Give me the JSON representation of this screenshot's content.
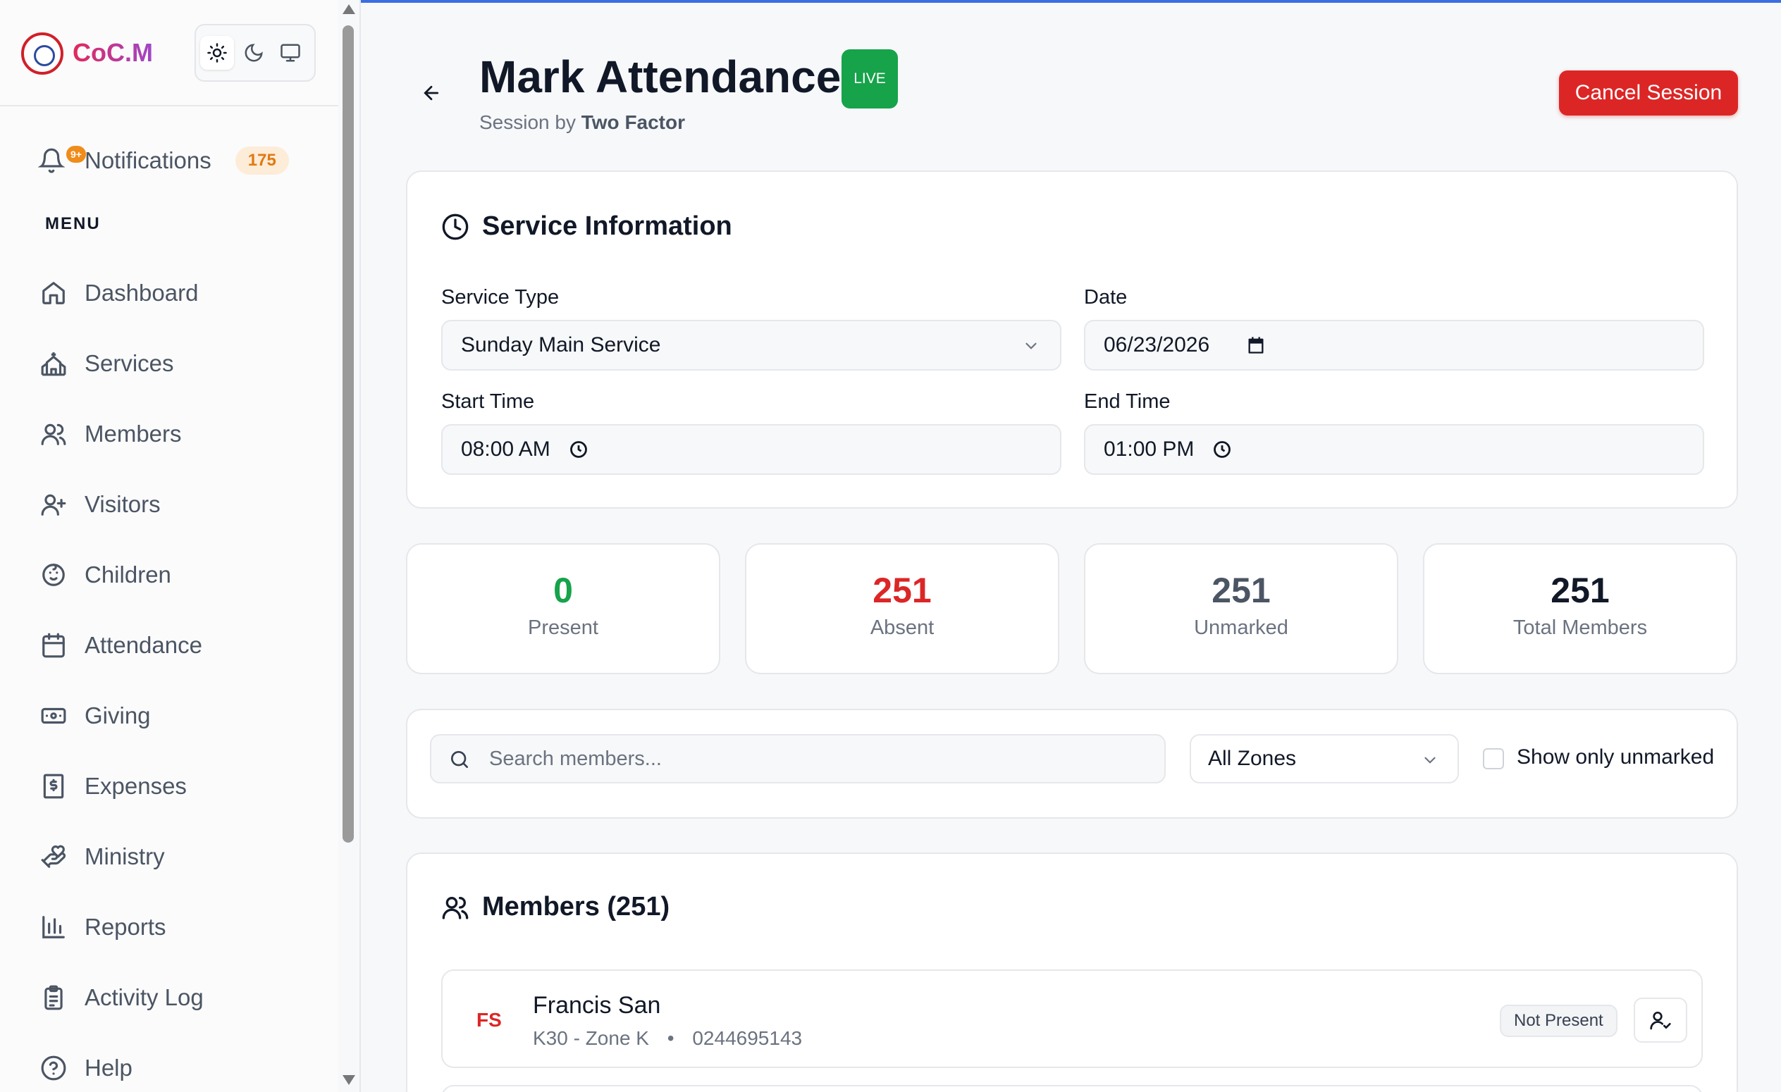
{
  "brand": {
    "name": "CoC.M"
  },
  "theme_toggle": [
    "sun-icon",
    "moon-icon",
    "monitor-icon"
  ],
  "notifications": {
    "label": "Notifications",
    "badge": "9+",
    "count": "175"
  },
  "menu_heading": "MENU",
  "nav": [
    {
      "label": "Dashboard",
      "icon": "home-icon"
    },
    {
      "label": "Services",
      "icon": "church-icon"
    },
    {
      "label": "Members",
      "icon": "users-icon"
    },
    {
      "label": "Visitors",
      "icon": "user-plus-icon"
    },
    {
      "label": "Children",
      "icon": "baby-icon"
    },
    {
      "label": "Attendance",
      "icon": "calendar-icon"
    },
    {
      "label": "Giving",
      "icon": "banknote-icon"
    },
    {
      "label": "Expenses",
      "icon": "receipt-icon"
    },
    {
      "label": "Ministry",
      "icon": "hand-heart-icon"
    },
    {
      "label": "Reports",
      "icon": "bar-chart-icon"
    },
    {
      "label": "Activity Log",
      "icon": "clipboard-icon"
    },
    {
      "label": "Help",
      "icon": "help-circle-icon"
    }
  ],
  "header": {
    "title": "Mark Attendance",
    "live_badge": "LIVE",
    "subtitle_prefix": "Session by",
    "subtitle_name": "Two Factor",
    "cancel_label": "Cancel Session"
  },
  "service_info": {
    "title": "Service Information",
    "service_type_label": "Service Type",
    "service_type_value": "Sunday Main Service",
    "date_label": "Date",
    "date_value": "06/23/2026",
    "start_label": "Start Time",
    "start_value": "08:00 AM",
    "end_label": "End Time",
    "end_value": "01:00 PM"
  },
  "stats": [
    {
      "value": "0",
      "label": "Present",
      "color": "#16a34a"
    },
    {
      "value": "251",
      "label": "Absent",
      "color": "#dc2626"
    },
    {
      "value": "251",
      "label": "Unmarked",
      "color": "#4b5563"
    },
    {
      "value": "251",
      "label": "Total Members",
      "color": "#111827"
    }
  ],
  "filters": {
    "search_placeholder": "Search members...",
    "zone_value": "All Zones",
    "unmarked_label": "Show only unmarked"
  },
  "members": {
    "title": "Members (251)",
    "rows": [
      {
        "initials": "FS",
        "name": "Francis San",
        "zone": "K30 - Zone K",
        "phone": "0244695143",
        "status": "Not Present"
      }
    ]
  },
  "colors": {
    "accent_red": "#dc2626",
    "live_green": "#16a34a",
    "notif_orange": "#f08c1a"
  }
}
